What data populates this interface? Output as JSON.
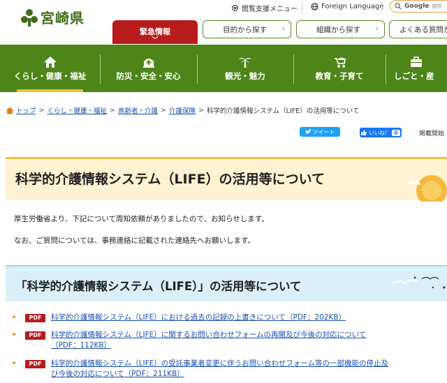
{
  "header": {
    "logo_text": "宮崎県",
    "util": {
      "accessibility_label": "閲覧支援メニュー",
      "language_label": "Foreign Language",
      "google_label": "Google",
      "google_sub": "提供"
    },
    "emergency_label": "緊急情報",
    "find_buttons": [
      "目的から探す",
      "組織から探す",
      "よくある質問から"
    ]
  },
  "nav": {
    "items": [
      {
        "label": "くらし・健康・福祉",
        "icon": "house-icon"
      },
      {
        "label": "防災・安全・安心",
        "icon": "ambulance-icon"
      },
      {
        "label": "観光・魅力",
        "icon": "palm-tree-icon"
      },
      {
        "label": "教育・子育て",
        "icon": "stroller-icon"
      },
      {
        "label": "しごと・産",
        "icon": "briefcase-icon"
      }
    ],
    "active_color": "#f2c230",
    "bg_color": "#4d8518"
  },
  "breadcrumb": {
    "items": [
      "トップ",
      "くらし・健康・福祉",
      "高齢者・介護",
      "介護保険"
    ],
    "current": "科学的介護情報システム（LIFE）の活用等について"
  },
  "social": {
    "tweet_label": "ツイート",
    "like_label": "いいね！",
    "like_count": "0",
    "pubdate_label": "掲載開始"
  },
  "page": {
    "title": "科学的介護情報システム（LIFE）の活用等について",
    "intro": [
      "厚生労働省より、下記について周知依頼がありましたので、お知らせします。",
      "なお、ご質問については、事務連絡に記載された連絡先へお願いします。"
    ],
    "section_heading": "「科学的介護情報システム（LIFE）」の活用等について",
    "documents": [
      {
        "badge": "PDF",
        "lines": [
          "科学的介護情報システム（LIFE）における過去の記録の上書きについて（PDF：202KB）"
        ]
      },
      {
        "badge": "PDF",
        "lines": [
          "科学的介護情報システム（LIFE）に関するお問い合わせフォームの再開及び今後の対応について",
          "（PDF：112KB）"
        ]
      },
      {
        "badge": "PDF",
        "lines": [
          "科学的介護情報システム（LIFE）の受託事業者変更に伴うお問い合わせフォーム等の一部機能の停止及",
          "び今後の対応について（PDF：211KB）"
        ]
      }
    ]
  }
}
